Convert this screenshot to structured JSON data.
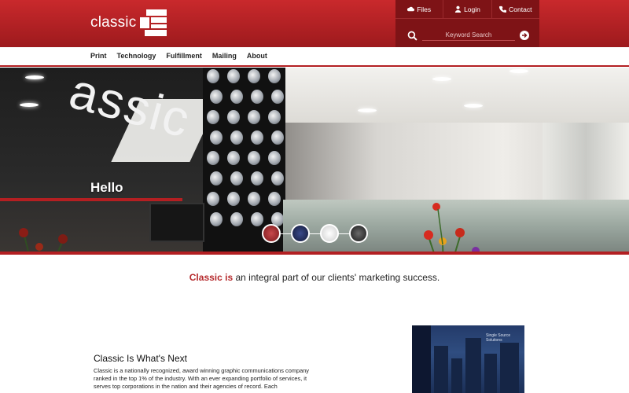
{
  "header": {
    "logo_text": "classic",
    "util_links": [
      {
        "label": "Files",
        "icon": "cloud-icon"
      },
      {
        "label": "Login",
        "icon": "user-icon"
      },
      {
        "label": "Contact",
        "icon": "phone-icon"
      }
    ],
    "search_placeholder": "Keyword Search"
  },
  "nav": {
    "items": [
      "Print",
      "Technology",
      "Fulfillment",
      "Mailing",
      "About"
    ]
  },
  "hero": {
    "deco_text": "assic",
    "heading": "Hello",
    "slides_count": 4
  },
  "tagline": {
    "highlight": "Classic is",
    "rest": " an integral part of our clients' marketing success."
  },
  "section": {
    "title": "Classic Is What's Next",
    "body": "Classic is a nationally recognized, award winning graphic communications company ranked in the top 1% of the industry. With an ever expanding portfolio of services, it serves top corporations in the nation and their agencies of record. Each"
  },
  "book": {
    "title": "Single Source Solutions"
  },
  "colors": {
    "brand_red": "#b31f22",
    "header_dark": "#7e1316"
  }
}
